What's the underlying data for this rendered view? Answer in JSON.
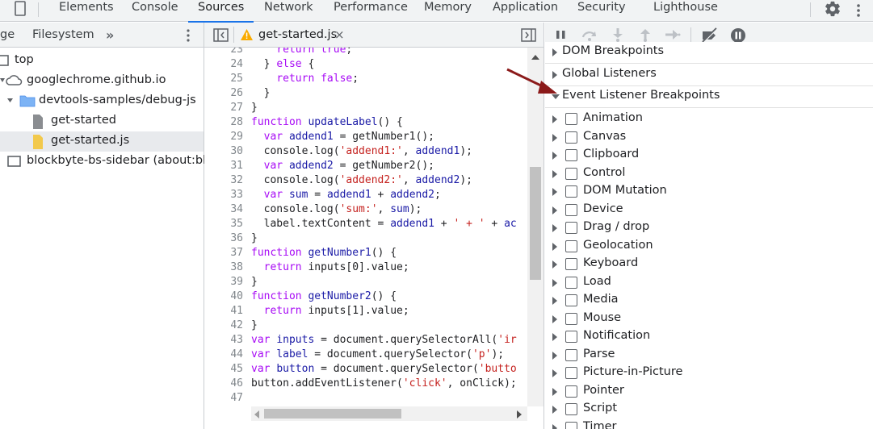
{
  "toolbar": {
    "tabs": [
      {
        "label": "Elements"
      },
      {
        "label": "Console"
      },
      {
        "label": "Sources"
      },
      {
        "label": "Network"
      },
      {
        "label": "Performance"
      },
      {
        "label": "Memory"
      },
      {
        "label": "Application"
      },
      {
        "label": "Security"
      },
      {
        "label": "Lighthouse"
      }
    ],
    "active_tab": "Sources",
    "accent_color": "#1a73e8"
  },
  "navigator": {
    "tabs": [
      {
        "label": "ge"
      },
      {
        "label": "Filesystem"
      }
    ],
    "more_tabs_glyph": "»",
    "tree": [
      {
        "label": "top",
        "icon": "frame-icon"
      },
      {
        "label": "googlechrome.github.io",
        "icon": "cloud-icon"
      },
      {
        "label": "devtools-samples/debug-js",
        "icon": "folder-icon"
      },
      {
        "label": "get-started",
        "icon": "file-icon"
      },
      {
        "label": "get-started.js",
        "icon": "js-file-icon"
      },
      {
        "label": "blockbyte-bs-sidebar (about:blan",
        "icon": "frame-icon"
      }
    ]
  },
  "editor": {
    "tab_name": "get-started.js",
    "close_glyph": "×",
    "lines": [
      {
        "n": "23",
        "code": [
          {
            "t": "    "
          },
          {
            "t": "return",
            "c": "kw"
          },
          {
            "t": " "
          },
          {
            "t": "true",
            "c": "kw"
          },
          {
            "t": ";"
          }
        ]
      },
      {
        "n": "24",
        "code": [
          {
            "t": "  } "
          },
          {
            "t": "else",
            "c": "kw"
          },
          {
            "t": " {"
          }
        ]
      },
      {
        "n": "25",
        "code": [
          {
            "t": "    "
          },
          {
            "t": "return",
            "c": "kw"
          },
          {
            "t": " "
          },
          {
            "t": "false",
            "c": "kw"
          },
          {
            "t": ";"
          }
        ]
      },
      {
        "n": "26",
        "code": [
          {
            "t": "  }"
          }
        ]
      },
      {
        "n": "27",
        "code": [
          {
            "t": "}"
          }
        ]
      },
      {
        "n": "28",
        "code": [
          {
            "t": "function",
            "c": "kw"
          },
          {
            "t": " "
          },
          {
            "t": "updateLabel",
            "c": "fn"
          },
          {
            "t": "() {"
          }
        ]
      },
      {
        "n": "29",
        "code": [
          {
            "t": "  "
          },
          {
            "t": "var",
            "c": "kw"
          },
          {
            "t": " "
          },
          {
            "t": "addend1",
            "c": "fn"
          },
          {
            "t": " = getNumber1();"
          }
        ]
      },
      {
        "n": "30",
        "code": [
          {
            "t": "  console.log("
          },
          {
            "t": "'addend1:'",
            "c": "str"
          },
          {
            "t": ", "
          },
          {
            "t": "addend1",
            "c": "fn"
          },
          {
            "t": ");"
          }
        ]
      },
      {
        "n": "31",
        "code": [
          {
            "t": "  "
          },
          {
            "t": "var",
            "c": "kw"
          },
          {
            "t": " "
          },
          {
            "t": "addend2",
            "c": "fn"
          },
          {
            "t": " = getNumber2();"
          }
        ]
      },
      {
        "n": "32",
        "code": [
          {
            "t": "  console.log("
          },
          {
            "t": "'addend2:'",
            "c": "str"
          },
          {
            "t": ", "
          },
          {
            "t": "addend2",
            "c": "fn"
          },
          {
            "t": ");"
          }
        ]
      },
      {
        "n": "33",
        "code": [
          {
            "t": "  "
          },
          {
            "t": "var",
            "c": "kw"
          },
          {
            "t": " "
          },
          {
            "t": "sum",
            "c": "fn"
          },
          {
            "t": " = "
          },
          {
            "t": "addend1",
            "c": "fn"
          },
          {
            "t": " + "
          },
          {
            "t": "addend2",
            "c": "fn"
          },
          {
            "t": ";"
          }
        ]
      },
      {
        "n": "34",
        "code": [
          {
            "t": "  console.log("
          },
          {
            "t": "'sum:'",
            "c": "str"
          },
          {
            "t": ", "
          },
          {
            "t": "sum",
            "c": "fn"
          },
          {
            "t": ");"
          }
        ]
      },
      {
        "n": "35",
        "code": [
          {
            "t": "  label.textContent = "
          },
          {
            "t": "addend1",
            "c": "fn"
          },
          {
            "t": " + "
          },
          {
            "t": "' + '",
            "c": "str"
          },
          {
            "t": " + "
          },
          {
            "t": "ac",
            "c": "fn"
          }
        ]
      },
      {
        "n": "36",
        "code": [
          {
            "t": "}"
          }
        ]
      },
      {
        "n": "37",
        "code": [
          {
            "t": "function",
            "c": "kw"
          },
          {
            "t": " "
          },
          {
            "t": "getNumber1",
            "c": "fn"
          },
          {
            "t": "() {"
          }
        ]
      },
      {
        "n": "38",
        "code": [
          {
            "t": "  "
          },
          {
            "t": "return",
            "c": "kw"
          },
          {
            "t": " inputs[0].value;"
          }
        ]
      },
      {
        "n": "39",
        "code": [
          {
            "t": "}"
          }
        ]
      },
      {
        "n": "40",
        "code": [
          {
            "t": "function",
            "c": "kw"
          },
          {
            "t": " "
          },
          {
            "t": "getNumber2",
            "c": "fn"
          },
          {
            "t": "() {"
          }
        ]
      },
      {
        "n": "41",
        "code": [
          {
            "t": "  "
          },
          {
            "t": "return",
            "c": "kw"
          },
          {
            "t": " inputs[1].value;"
          }
        ]
      },
      {
        "n": "42",
        "code": [
          {
            "t": "}"
          }
        ]
      },
      {
        "n": "43",
        "code": [
          {
            "t": "var",
            "c": "kw"
          },
          {
            "t": " "
          },
          {
            "t": "inputs",
            "c": "fn"
          },
          {
            "t": " = document.querySelectorAll("
          },
          {
            "t": "'ir",
            "c": "str"
          }
        ]
      },
      {
        "n": "44",
        "code": [
          {
            "t": "var",
            "c": "kw"
          },
          {
            "t": " "
          },
          {
            "t": "label",
            "c": "fn"
          },
          {
            "t": " = document.querySelector("
          },
          {
            "t": "'p'",
            "c": "str"
          },
          {
            "t": ");"
          }
        ]
      },
      {
        "n": "45",
        "code": [
          {
            "t": "var",
            "c": "kw"
          },
          {
            "t": " "
          },
          {
            "t": "button",
            "c": "fn"
          },
          {
            "t": " = document.querySelector("
          },
          {
            "t": "'butto",
            "c": "str"
          }
        ]
      },
      {
        "n": "46",
        "code": [
          {
            "t": "button.addEventListener("
          },
          {
            "t": "'click'",
            "c": "str"
          },
          {
            "t": ", onClick);"
          }
        ]
      },
      {
        "n": "47",
        "code": []
      }
    ]
  },
  "debugger": {
    "sections": [
      {
        "label": "DOM Breakpoints",
        "expanded": false
      },
      {
        "label": "Global Listeners",
        "expanded": false
      },
      {
        "label": "Event Listener Breakpoints",
        "expanded": true
      }
    ],
    "event_breakpoints": [
      {
        "label": "Animation"
      },
      {
        "label": "Canvas"
      },
      {
        "label": "Clipboard"
      },
      {
        "label": "Control"
      },
      {
        "label": "DOM Mutation"
      },
      {
        "label": "Device"
      },
      {
        "label": "Drag / drop"
      },
      {
        "label": "Geolocation"
      },
      {
        "label": "Keyboard"
      },
      {
        "label": "Load"
      },
      {
        "label": "Media"
      },
      {
        "label": "Mouse"
      },
      {
        "label": "Notification"
      },
      {
        "label": "Parse"
      },
      {
        "label": "Picture-in-Picture"
      },
      {
        "label": "Pointer"
      },
      {
        "label": "Script"
      },
      {
        "label": "Timer"
      }
    ],
    "annotation_arrow_color": "#8b1a1a"
  }
}
